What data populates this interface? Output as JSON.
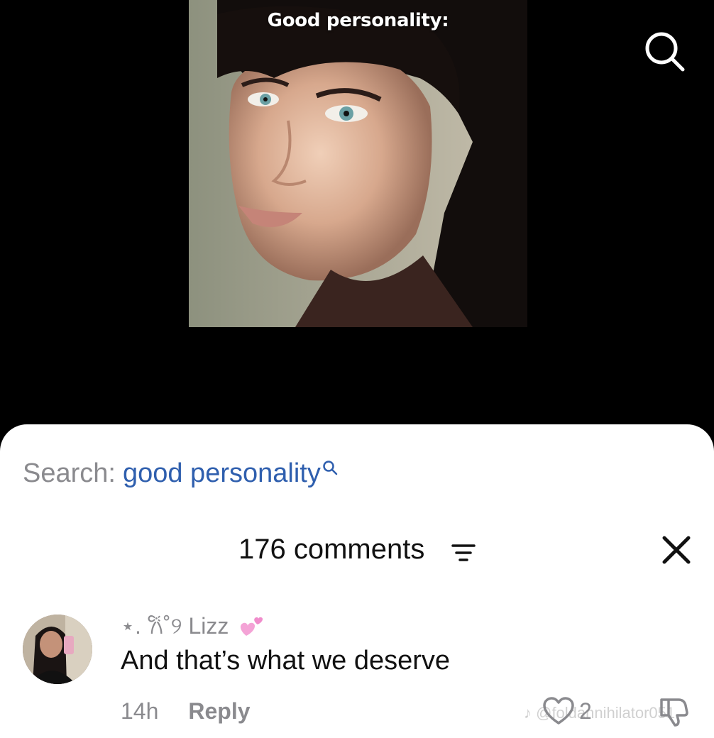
{
  "video": {
    "caption": "Good personality:",
    "search_icon": "search-icon"
  },
  "comments_panel": {
    "search_prefix": "Search:",
    "search_term": "good personality",
    "search_icon": "search-icon",
    "count_label": "176 comments",
    "filter_icon": "filter-icon",
    "close_icon": "close-icon"
  },
  "comment": {
    "username": "⋆. 𐙚˚୨ Lizz",
    "decoration_icon": "two-hearts-icon",
    "text": "And that’s what we deserve",
    "time": "14h",
    "reply_label": "Reply",
    "like_icon": "heart-outline-icon",
    "likes": "2",
    "dislike_icon": "thumbs-down-icon"
  },
  "watermark": {
    "text": "♪ @foldannihilator051"
  },
  "colors": {
    "background": "#000000",
    "sheet": "#ffffff",
    "search_term": "#2f5fae",
    "muted": "#8a8a8e",
    "text": "#111111"
  }
}
